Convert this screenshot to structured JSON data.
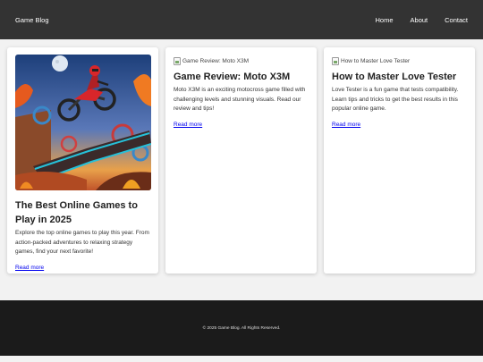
{
  "header": {
    "brand": "Game Blog",
    "nav": [
      "Home",
      "About",
      "Contact"
    ]
  },
  "cards": [
    {
      "title": "The Best Online Games to Play in 2025",
      "description": "Explore the top online games to play this year. From action-packed adventures to relaxing strategy games, find your next favorite!",
      "link": "Read more"
    },
    {
      "image_alt": "Game Review: Moto X3M",
      "title": "Game Review: Moto X3M",
      "description": "Moto X3M is an exciting motocross game filled with challenging levels and stunning visuals. Read our review and tips!",
      "link": "Read more"
    },
    {
      "image_alt": "How to Master Love Tester",
      "title": "How to Master Love Tester",
      "description": "Love Tester is a fun game that tests compatibility. Learn tips and tricks to get the best results in this popular online game.",
      "link": "Read more"
    }
  ],
  "footer": {
    "copyright": "© 2025 Game Blog. All Rights Reserved."
  },
  "colors": {
    "header_bg": "#333333",
    "footer_bg": "#1b1b1b",
    "link": "#0000ee"
  }
}
